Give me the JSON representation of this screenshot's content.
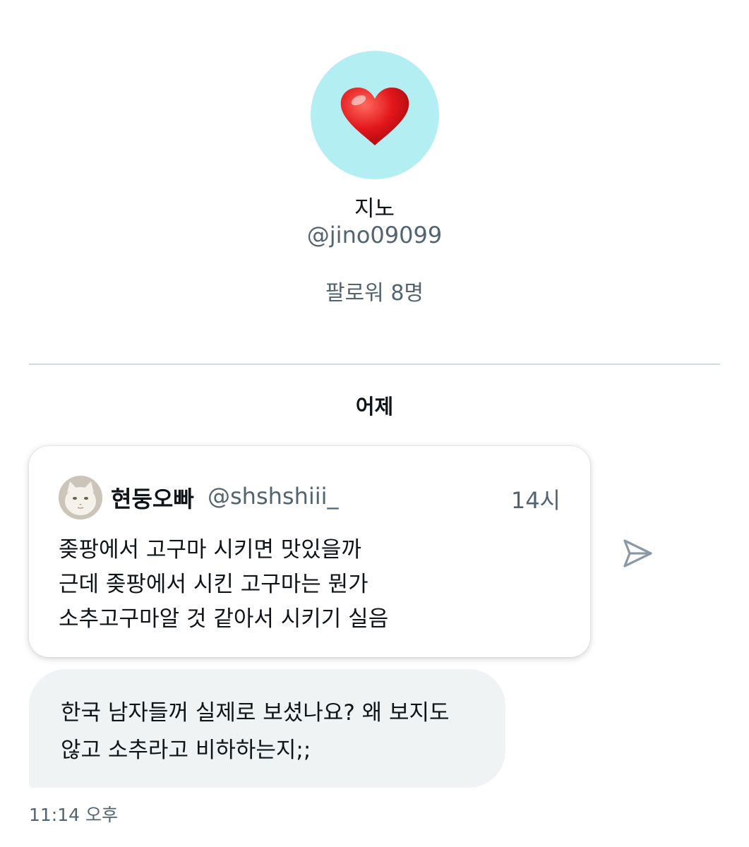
{
  "profile": {
    "display_name": "지노",
    "handle": "@jino09099",
    "followers": "팔로워 8명",
    "avatar_icon": "heart-icon",
    "avatar_bg": "#b3eef2"
  },
  "day_separator": "어제",
  "quote": {
    "author_name": "현둥오빠",
    "author_handle": "@shshshiii_",
    "time": "14시",
    "lines": [
      "좆팡에서 고구마 시키면 맛있을까",
      "근데 좆팡에서 시킨 고구마는 뭔가",
      "소추고구마알 것 같아서 시키기 실음"
    ]
  },
  "message": {
    "lines": [
      "한국 남자들꺼 실제로 보셨나요? 왜 보지도",
      "않고 소추라고 비하하는지;;"
    ],
    "time": "11:14 오후"
  },
  "icons": {
    "share": "send-icon"
  },
  "colors": {
    "secondary_text": "#536471",
    "bubble_bg": "#eff3f4",
    "divider": "#cfd9de"
  }
}
